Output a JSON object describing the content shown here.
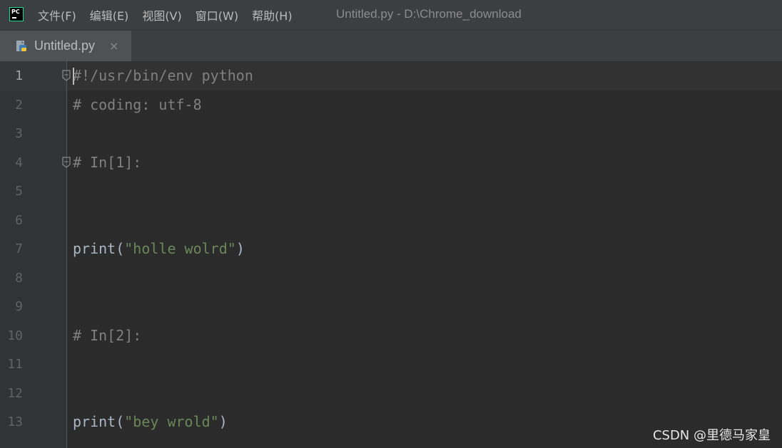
{
  "menubar": {
    "items": [
      "文件(F)",
      "编辑(E)",
      "视图(V)",
      "窗口(W)",
      "帮助(H)"
    ]
  },
  "window_title": "Untitled.py - D:\\Chrome_download",
  "tab": {
    "label": "Untitled.py",
    "close": "×"
  },
  "editor": {
    "line_numbers": [
      "1",
      "2",
      "3",
      "4",
      "5",
      "6",
      "7",
      "8",
      "9",
      "10",
      "11",
      "12",
      "13"
    ],
    "current_line": 1,
    "lines": [
      {
        "n": 1,
        "parts": [
          {
            "t": "#!/usr/bin/env python",
            "c": "cm"
          }
        ]
      },
      {
        "n": 2,
        "parts": [
          {
            "t": "# coding: utf-8",
            "c": "cm"
          }
        ]
      },
      {
        "n": 4,
        "parts": [
          {
            "t": "# In[1]:",
            "c": "cm"
          }
        ]
      },
      {
        "n": 7,
        "parts": [
          {
            "t": "print",
            "c": "kw"
          },
          {
            "t": "(",
            "c": "kw"
          },
          {
            "t": "\"holle wolrd\"",
            "c": "str"
          },
          {
            "t": ")",
            "c": "kw"
          }
        ]
      },
      {
        "n": 10,
        "parts": [
          {
            "t": "# In[2]:",
            "c": "cm"
          }
        ]
      },
      {
        "n": 13,
        "parts": [
          {
            "t": "print",
            "c": "kw"
          },
          {
            "t": "(",
            "c": "kw"
          },
          {
            "t": "\"bey wrold\"",
            "c": "str"
          },
          {
            "t": ")",
            "c": "kw"
          }
        ]
      }
    ]
  },
  "colors": {
    "comment": "#808080",
    "string": "#6a8759",
    "text": "#a9b7c6",
    "background": "#2b2b2b"
  },
  "watermark": "CSDN @里德马家皇"
}
